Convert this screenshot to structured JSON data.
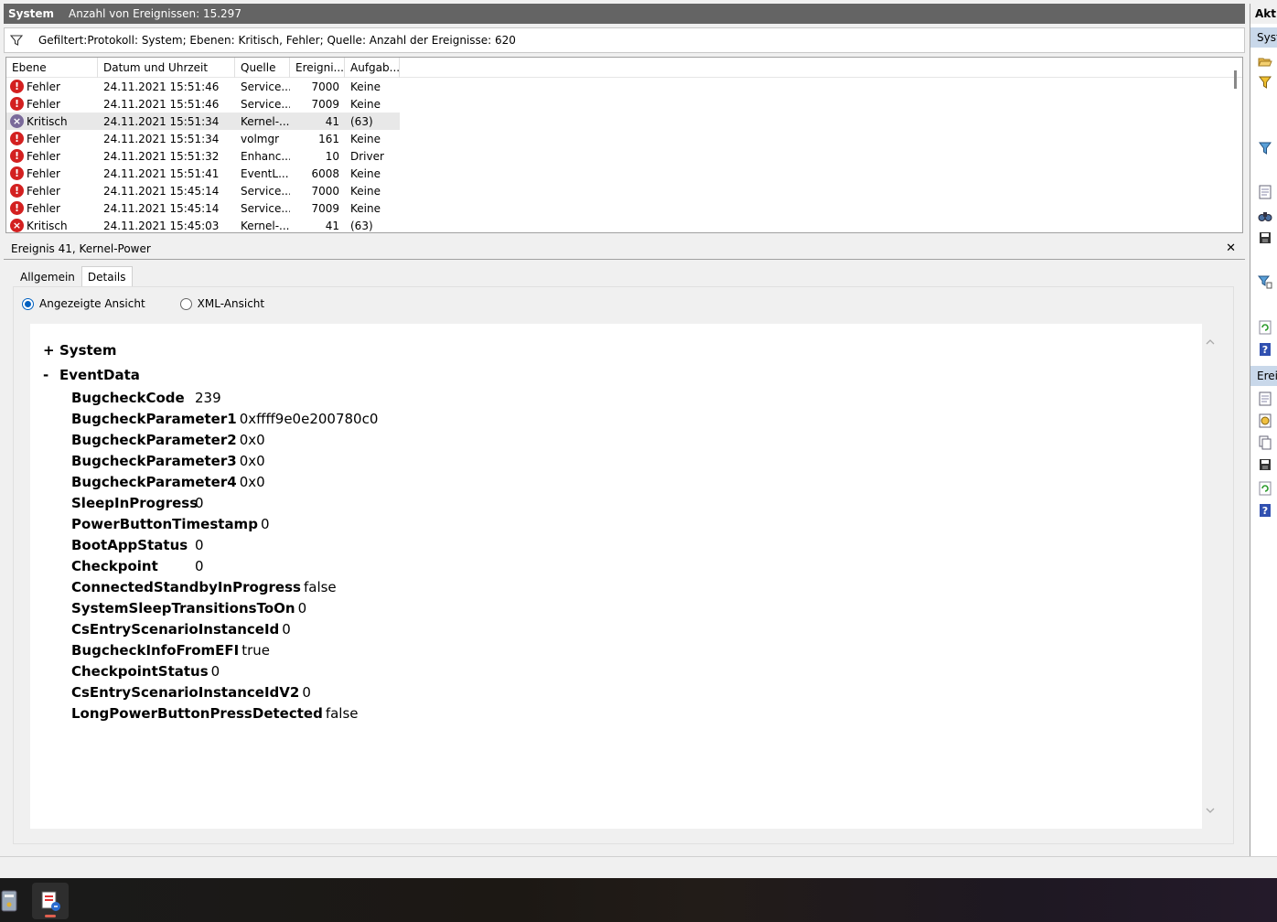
{
  "titlebar": {
    "log_name": "System",
    "event_count": "Anzahl von Ereignissen: 15.297"
  },
  "filter": {
    "text": "Gefiltert:Protokoll: System; Ebenen: Kritisch, Fehler; Quelle:  Anzahl der Ereignisse: 620"
  },
  "list": {
    "columns": [
      "Ebene",
      "Datum und Uhrzeit",
      "Quelle",
      "Ereigni...",
      "Aufgab..."
    ],
    "rows": [
      {
        "level": "Fehler",
        "datetime": "24.11.2021 15:51:46",
        "source": "Service...",
        "id": "7000",
        "task": "Keine"
      },
      {
        "level": "Fehler",
        "datetime": "24.11.2021 15:51:46",
        "source": "Service...",
        "id": "7009",
        "task": "Keine"
      },
      {
        "level": "Kritisch",
        "datetime": "24.11.2021 15:51:34",
        "source": "Kernel-...",
        "id": "41",
        "task": "(63)"
      },
      {
        "level": "Fehler",
        "datetime": "24.11.2021 15:51:34",
        "source": "volmgr",
        "id": "161",
        "task": "Keine"
      },
      {
        "level": "Fehler",
        "datetime": "24.11.2021 15:51:32",
        "source": "Enhanc...",
        "id": "10",
        "task": "Driver"
      },
      {
        "level": "Fehler",
        "datetime": "24.11.2021 15:51:41",
        "source": "EventL...",
        "id": "6008",
        "task": "Keine"
      },
      {
        "level": "Fehler",
        "datetime": "24.11.2021 15:45:14",
        "source": "Service...",
        "id": "7000",
        "task": "Keine"
      },
      {
        "level": "Fehler",
        "datetime": "24.11.2021 15:45:14",
        "source": "Service...",
        "id": "7009",
        "task": "Keine"
      },
      {
        "level": "Kritisch",
        "datetime": "24.11.2021 15:45:03",
        "source": "Kernel-...",
        "id": "41",
        "task": "(63)"
      }
    ]
  },
  "detail": {
    "title": "Ereignis 41, Kernel-Power",
    "close_glyph": "✕",
    "tabs": [
      "Allgemein",
      "Details"
    ],
    "active_tab": "Details",
    "view_modes": [
      "Angezeigte Ansicht",
      "XML-Ansicht"
    ],
    "selected_view": "Angezeigte Ansicht",
    "sections": [
      {
        "sign": "+",
        "name": "System"
      },
      {
        "sign": "-",
        "name": "EventData"
      }
    ],
    "event_data": [
      {
        "key": "BugcheckCode",
        "value": "239"
      },
      {
        "key": "BugcheckParameter1",
        "value": "0xffff9e0e200780c0"
      },
      {
        "key": "BugcheckParameter2",
        "value": "0x0"
      },
      {
        "key": "BugcheckParameter3",
        "value": "0x0"
      },
      {
        "key": "BugcheckParameter4",
        "value": "0x0"
      },
      {
        "key": "SleepInProgress",
        "value": "0"
      },
      {
        "key": "PowerButtonTimestamp",
        "value": "0"
      },
      {
        "key": "BootAppStatus",
        "value": "0"
      },
      {
        "key": "Checkpoint",
        "value": "0"
      },
      {
        "key": "ConnectedStandbyInProgress",
        "value": "false"
      },
      {
        "key": "SystemSleepTransitionsToOn",
        "value": "0"
      },
      {
        "key": "CsEntryScenarioInstanceId",
        "value": "0"
      },
      {
        "key": "BugcheckInfoFromEFI",
        "value": "true"
      },
      {
        "key": "CheckpointStatus",
        "value": "0"
      },
      {
        "key": "CsEntryScenarioInstanceIdV2",
        "value": "0"
      },
      {
        "key": "LongPowerButtonPressDetected",
        "value": "false"
      }
    ]
  },
  "actions": {
    "header": "Akti",
    "section1": "Syst",
    "section2": "Ereig",
    "section1_icons": [
      "open-folder-icon",
      "filter-icon",
      "filter-clear-icon",
      "properties-icon",
      "find-icon",
      "save-icon",
      "attach-task-icon",
      "refresh-icon",
      "help-icon"
    ],
    "section2_icons": [
      "event-properties-icon",
      "attach-task-icon",
      "copy-icon",
      "save-icon",
      "refresh-icon",
      "help-icon"
    ]
  },
  "taskbar": {
    "items": [
      "server-manager-icon",
      "event-viewer-icon"
    ]
  },
  "colors": {
    "error": "#d32020",
    "accent": "#0060c0",
    "selection": "#c9d8ea"
  }
}
